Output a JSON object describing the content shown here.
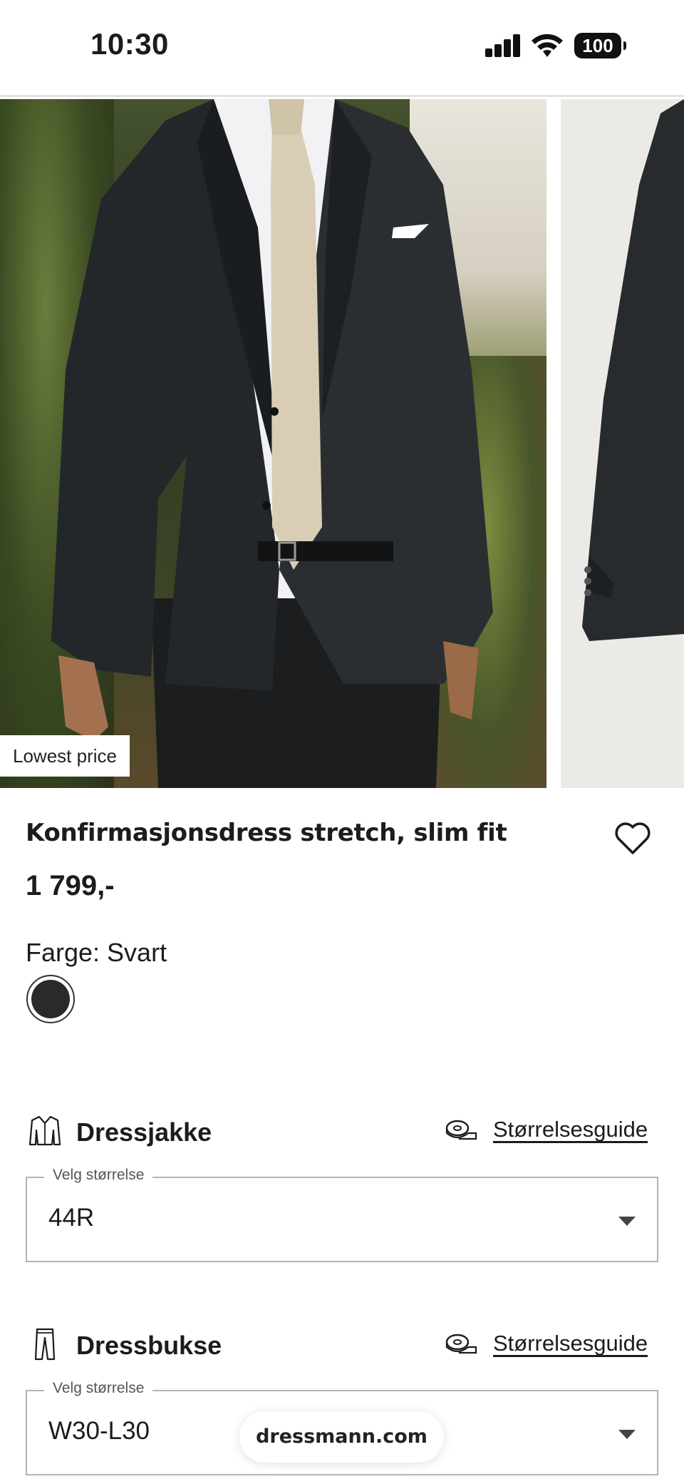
{
  "status_bar": {
    "time": "10:30",
    "battery": "100"
  },
  "gallery": {
    "badge": "Lowest price"
  },
  "product": {
    "title": "Konfirmasjonsdress stretch, slim fit",
    "price": "1 799,-",
    "color_label": "Farge: Svart",
    "swatch_color": "#2a2a2a"
  },
  "sections": [
    {
      "title": "Dressjakke",
      "guide": "Størrelsesguide",
      "legend": "Velg størrelse",
      "value": "44R"
    },
    {
      "title": "Dressbukse",
      "guide": "Størrelsesguide",
      "legend": "Velg størrelse",
      "value": "W30-L30"
    }
  ],
  "browser": {
    "url": "dressmann.com"
  },
  "icons": [
    "signal-icon",
    "wifi-icon",
    "battery-icon",
    "heart-icon",
    "jacket-icon",
    "tape-measure-icon",
    "trousers-icon",
    "chevron-down-icon"
  ]
}
